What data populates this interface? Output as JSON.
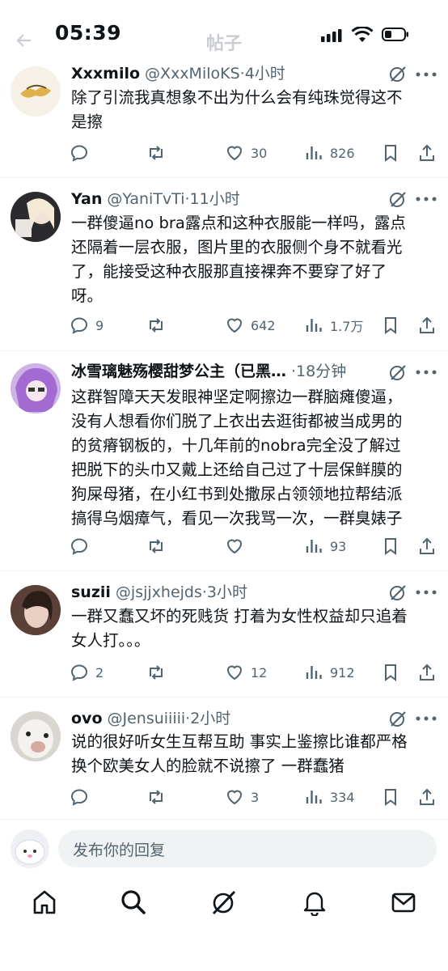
{
  "status": {
    "time": "05:39"
  },
  "header": {
    "title": "帖子"
  },
  "posts": [
    {
      "name": "Xxxmilo",
      "handle": "@XxxMiloKS",
      "time": "·4小时",
      "lines": [
        "除了引流我真想象不出为什么会有纯珠觉得这不",
        "是擦"
      ],
      "replies": "",
      "likes": "30",
      "views": "826"
    },
    {
      "name": "Yan",
      "handle": "@YaniTvTi",
      "time": "·11小时",
      "lines": [
        "一群傻逼no bra露点和这种衣服能一样吗，露点",
        "还隔着一层衣服，图片里的衣服侧个身不就看光",
        "了，能接受这种衣服那直接裸奔不要穿了好了",
        "呀。"
      ],
      "replies": "9",
      "likes": "642",
      "views": "1.7万"
    },
    {
      "name": "冰雪璃魅殇樱甜梦公主（已黑…",
      "handle": "",
      "time": "·18分钟",
      "lines": [
        "这群智障天天发眼神坚定啊擦边一群脑瘫傻逼，",
        "没有人想看你们脱了上衣出去逛街都被当成男的",
        "的贫瘠钢板的，十几年前的nobra完全没了解过",
        "把脱下的头巾又戴上还给自己过了十层保鲜膜的",
        "狗屎母猪，在小红书到处撒尿占领领地拉帮结派",
        "搞得乌烟瘴气，看见一次我骂一次，一群臭婊子"
      ],
      "replies": "",
      "likes": "",
      "views": "93"
    },
    {
      "name": "suzii",
      "handle": "@jsjjxhejds",
      "time": "·3小时",
      "lines": [
        "一群又蠢又坏的死贱货 打着为女性权益却只追着",
        "女人打。。。"
      ],
      "replies": "2",
      "likes": "12",
      "views": "912"
    },
    {
      "name": "ovo",
      "handle": "@Jensuiiiii",
      "time": "·2小时",
      "lines": [
        "说的很好听女生互帮互助 事实上鉴擦比谁都严格",
        "换个欧美女人的脸就不说擦了 一群蠢猪"
      ],
      "replies": "",
      "likes": "3",
      "views": "334"
    }
  ],
  "reply": {
    "placeholder": "发布你的回复"
  },
  "colors": {
    "text": "#0f1419",
    "muted": "#536471",
    "divider": "#eff3f4"
  }
}
